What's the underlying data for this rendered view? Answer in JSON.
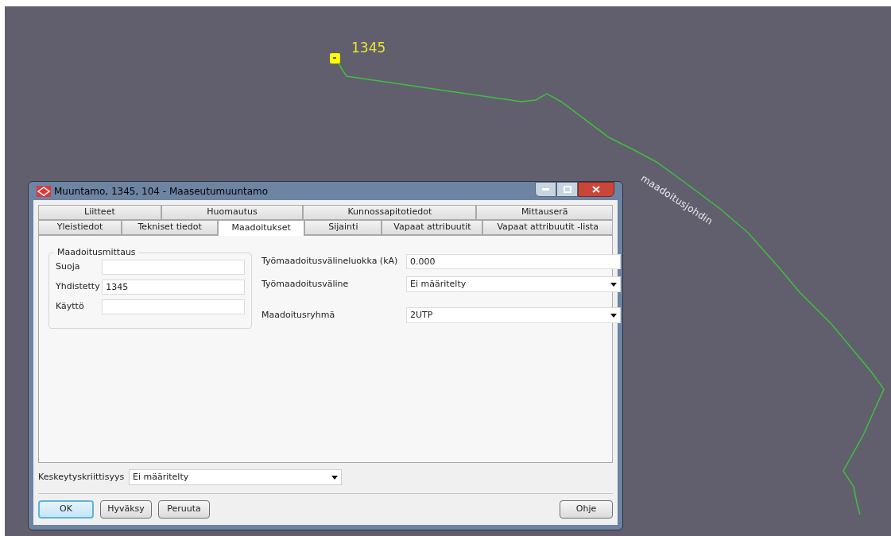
{
  "map": {
    "node_label": "1345",
    "line_label": "maadoitusjohdin"
  },
  "window": {
    "title": "Muuntamo, 1345, 104 - Maaseutumuuntamo"
  },
  "tab_rows": [
    [
      {
        "label": "Liitteet",
        "selected": false
      },
      {
        "label": "Huomautus",
        "selected": false
      },
      {
        "label": "Kunnossapitotiedot",
        "selected": false
      },
      {
        "label": "Mittauserä",
        "selected": false
      }
    ],
    [
      {
        "label": "Yleistiedot",
        "selected": false
      },
      {
        "label": "Tekniset tiedot",
        "selected": false
      },
      {
        "label": "Maadoitukset",
        "selected": true
      },
      {
        "label": "Sijainti",
        "selected": false
      },
      {
        "label": "Vapaat attribuutit",
        "selected": false
      },
      {
        "label": "Vapaat attribuutit -lista",
        "selected": false
      }
    ]
  ],
  "group": {
    "title": "Maadoitusmittaus",
    "fields": [
      {
        "label": "Suoja"
      },
      {
        "label": "Yhdistetty",
        "value": "1345"
      },
      {
        "label": "Käyttö"
      }
    ]
  },
  "right_fields": [
    {
      "kind": "text",
      "label": "Työmaadoitusvälineluokka (kA)",
      "value": "0.000"
    },
    {
      "kind": "combo",
      "label": "Työmaadoitusväline",
      "value": "Ei määritelty"
    },
    {
      "kind": "combo",
      "label": "Maadoitusryhmä",
      "value": "2UTP"
    }
  ],
  "bottom_field": {
    "label": "Keskeytyskriittisyys",
    "value": "Ei määritelty"
  },
  "buttons": [
    {
      "label": "OK",
      "default": true
    },
    {
      "label": "Hyväksy",
      "default": false
    },
    {
      "label": "Peruuta",
      "default": false
    }
  ],
  "help_button": {
    "label": "Ohje"
  }
}
